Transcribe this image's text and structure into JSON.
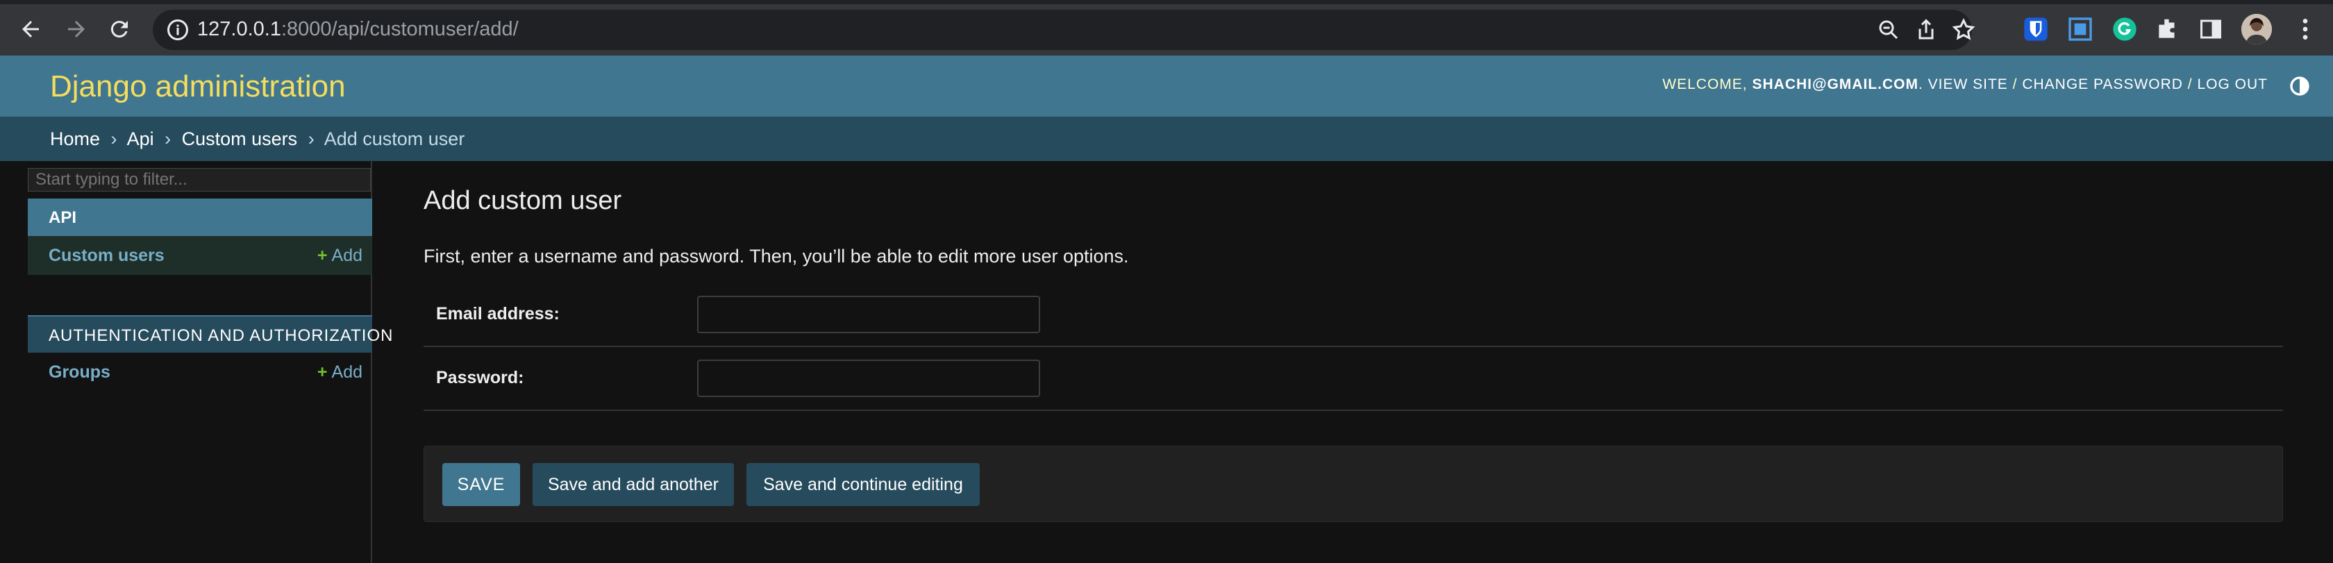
{
  "browser": {
    "url_host": "127.0.0.1",
    "url_rest": ":8000/api/customuser/add/",
    "icons": [
      "back-arrow-icon",
      "forward-arrow-icon",
      "reload-icon",
      "info-icon",
      "zoom-icon",
      "share-icon",
      "bookmark-star-icon",
      "bitwarden-icon",
      "screenshot-icon",
      "grammarly-icon",
      "extensions-puzzle-icon",
      "sidepanel-icon",
      "profile-avatar",
      "more-menu-icon"
    ]
  },
  "header": {
    "branding": "Django administration",
    "welcome": "Welcome, ",
    "user": "shachi@gmail.com",
    "after_user": ". ",
    "view_site": "View site",
    "sep1": " / ",
    "change_password": "Change password",
    "sep2": " / ",
    "log_out": "Log out"
  },
  "breadcrumbs": {
    "home": "Home",
    "sep": "›",
    "api": "Api",
    "custom_users": "Custom users",
    "current": "Add custom user"
  },
  "sidebar": {
    "filter_placeholder": "Start typing to filter...",
    "modules": [
      {
        "caption": "API",
        "models": [
          {
            "label": "Custom users",
            "add": "Add"
          }
        ]
      },
      {
        "caption": "AUTHENTICATION AND AUTHORIZATION",
        "models": [
          {
            "label": "Groups",
            "add": "Add"
          }
        ]
      }
    ],
    "plus": "+"
  },
  "main": {
    "title": "Add custom user",
    "help": "First, enter a username and password. Then, you’ll be able to edit more user options.",
    "fields": [
      {
        "label": "Email address:",
        "value": ""
      },
      {
        "label": "Password:",
        "value": ""
      }
    ],
    "buttons": {
      "save": "Save",
      "save_add_another": "Save and add another",
      "save_continue": "Save and continue editing"
    }
  },
  "colors": {
    "header_bg": "#417690",
    "breadcrumb_bg": "#264b5d",
    "branding": "#f5dd5d",
    "page_bg": "#121212",
    "link": "#79aec8",
    "add_plus": "#70bf2b"
  }
}
